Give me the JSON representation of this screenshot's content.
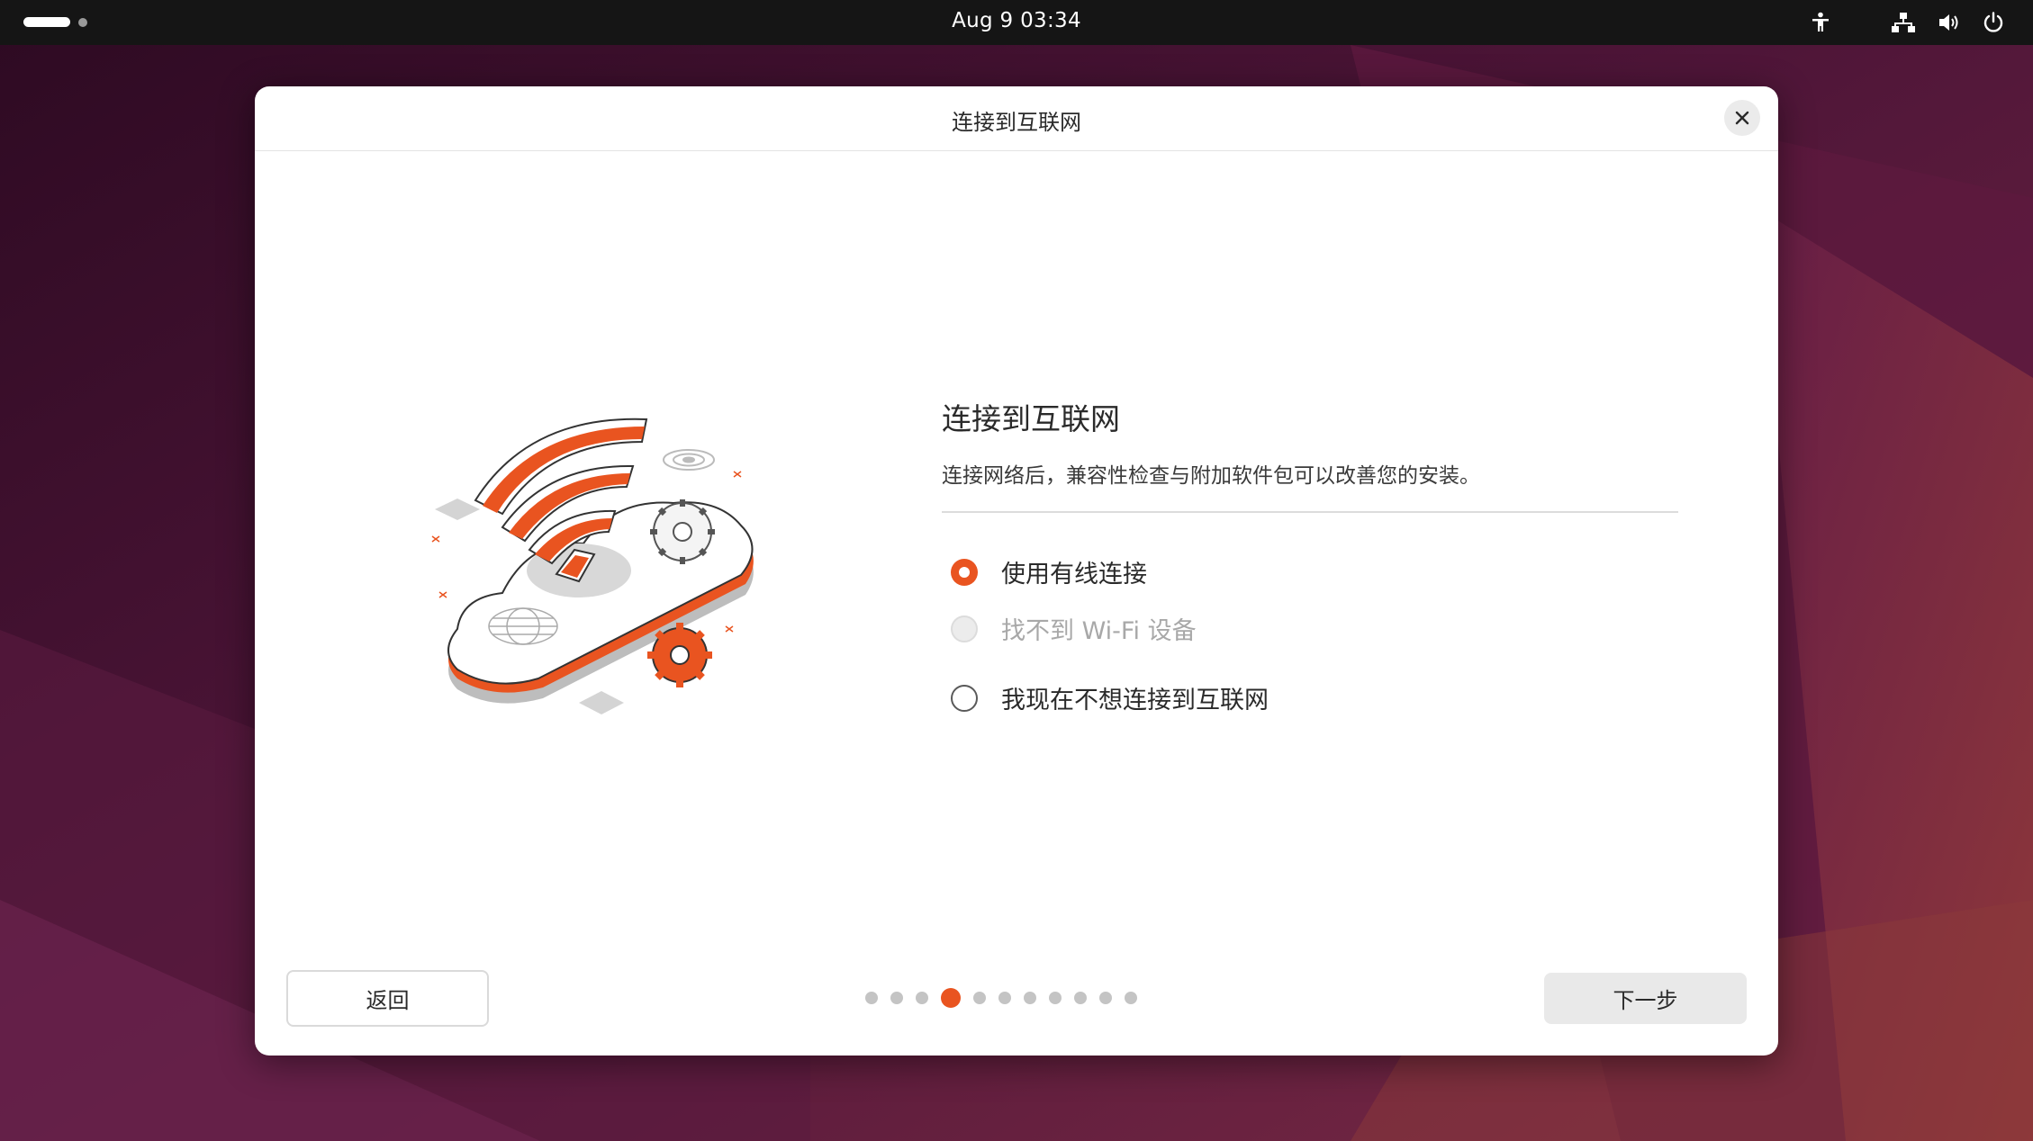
{
  "topbar": {
    "clock": "Aug 9  03:34",
    "icons": [
      "activities-indicator",
      "accessibility-icon",
      "network-wired-icon",
      "volume-icon",
      "power-icon"
    ]
  },
  "dialog": {
    "title": "连接到互联网",
    "heading": "连接到互联网",
    "subtitle": "连接网络后，兼容性检查与附加软件包可以改善您的安装。",
    "options": [
      {
        "label": "使用有线连接",
        "state": "selected"
      },
      {
        "label": "找不到 Wi-Fi 设备",
        "state": "disabled"
      },
      {
        "label": "我现在不想连接到互联网",
        "state": "unselected"
      }
    ],
    "back_label": "返回",
    "next_label": "下一步",
    "pager": {
      "total": 11,
      "current": 4
    }
  },
  "colors": {
    "accent": "#e95420",
    "topbar": "#151515",
    "dialog_bg": "#ffffff"
  }
}
